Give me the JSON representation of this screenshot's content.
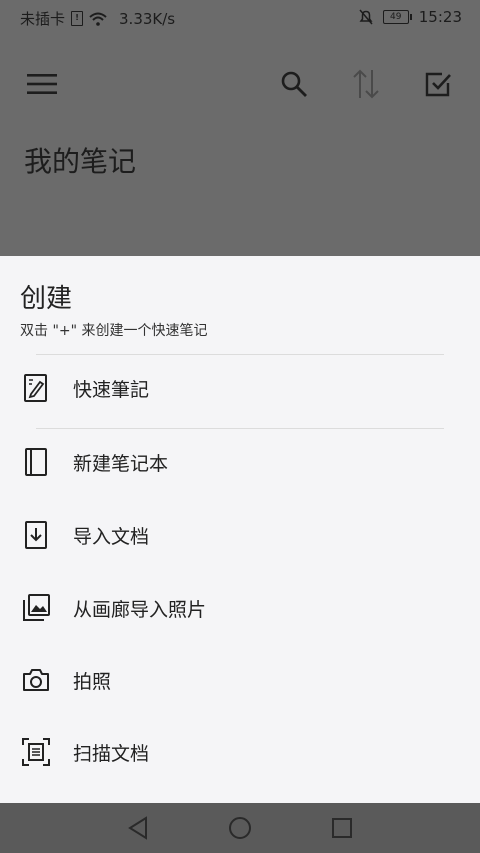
{
  "status": {
    "carrier": "未插卡",
    "speed": "3.33K/s",
    "battery": "49",
    "time": "15:23"
  },
  "app": {
    "title": "我的笔记"
  },
  "sheet": {
    "title": "创建",
    "subtitle": "双击 \"+\" 来创建一个快速笔记",
    "items": [
      {
        "label": "快速筆記",
        "icon": "quick-note-icon"
      },
      {
        "label": "新建笔记本",
        "icon": "notebook-icon"
      },
      {
        "label": "导入文档",
        "icon": "import-document-icon"
      },
      {
        "label": "从画廊导入照片",
        "icon": "gallery-icon"
      },
      {
        "label": "拍照",
        "icon": "camera-icon"
      },
      {
        "label": "扫描文档",
        "icon": "scan-document-icon"
      }
    ]
  },
  "colors": {
    "overlay": "#6b6b6b",
    "sheet": "#f5f5f7",
    "navbar": "#5a5a5a"
  }
}
